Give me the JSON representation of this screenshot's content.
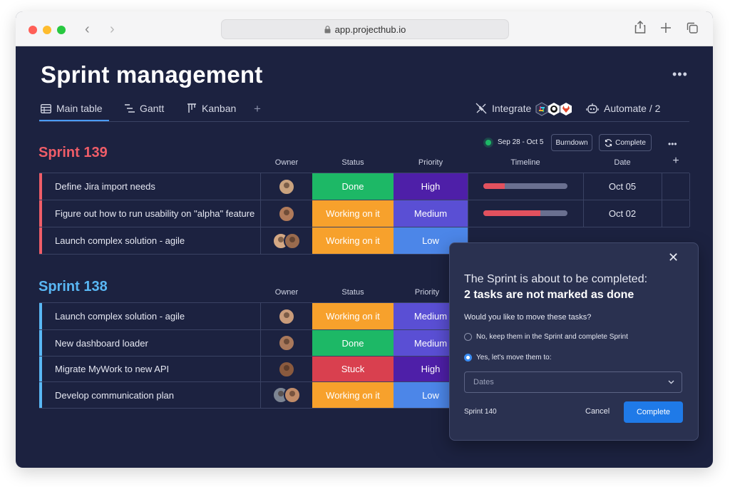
{
  "browser": {
    "url": "app.projecthub.io"
  },
  "page": {
    "title": "Sprint management",
    "more_label": "•••"
  },
  "tabs": [
    {
      "label": "Main table"
    },
    {
      "label": "Gantt"
    },
    {
      "label": "Kanban"
    },
    {
      "label": "+"
    }
  ],
  "toolbar": {
    "integrate_label": "Integrate",
    "automate_label": "Automate / 2"
  },
  "sprint139": {
    "title": "Sprint 139",
    "dates": "Sep 28 - Oct 5",
    "burndown_label": "Burndown",
    "complete_label": "Complete",
    "more_label": "•••",
    "columns": {
      "owner": "Owner",
      "status": "Status",
      "priority": "Priority",
      "timeline": "Timeline",
      "date": "Date",
      "add": "+"
    },
    "rows": [
      {
        "name": "Define Jira import needs",
        "status": "Done",
        "priority": "High",
        "timeline_progress": 0.25,
        "date": "Oct 05"
      },
      {
        "name": "Figure out how to run usability on \"alpha\" feature",
        "status": "Working on it",
        "priority": "Medium",
        "timeline_progress": 0.68,
        "date": "Oct 02"
      },
      {
        "name": "Launch complex solution - agile",
        "status": "Working on it",
        "priority": "Low"
      }
    ]
  },
  "sprint138": {
    "title": "Sprint 138",
    "columns": {
      "owner": "Owner",
      "status": "Status",
      "priority": "Priority"
    },
    "rows": [
      {
        "name": "Launch complex solution - agile",
        "status": "Working on it",
        "priority": "Medium"
      },
      {
        "name": "New dashboard loader",
        "status": "Done",
        "priority": "Medium"
      },
      {
        "name": "Migrate MyWork to new API",
        "status": "Stuck",
        "priority": "High"
      },
      {
        "name": "Develop communication plan",
        "status": "Working on it",
        "priority": "Low"
      }
    ]
  },
  "modal": {
    "close_label": "✕",
    "heading_line1": "The Sprint is about to be completed:",
    "heading_line2": "2 tasks are not marked as done",
    "question": "Would you like to move these tasks?",
    "option_keep": "No, keep them in the Sprint and complete Sprint",
    "option_move": "Yes, let's move them to:",
    "select_placeholder": "Dates",
    "footer_label": "Sprint 140",
    "cancel_label": "Cancel",
    "complete_label": "Complete"
  },
  "colors": {
    "background": "#1c2240",
    "done": "#1db866",
    "working": "#f7a12c",
    "stuck": "#d9404f",
    "high": "#4e1fa8",
    "medium": "#5a4fd4",
    "low": "#4c86e8",
    "sprint139": "#ef5d68",
    "sprint138": "#59b7f4",
    "accent": "#1f7ae8"
  }
}
